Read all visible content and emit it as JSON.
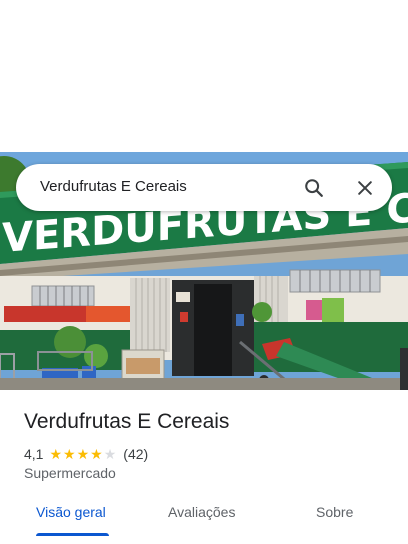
{
  "search": {
    "query": "Verdufrutas E Cereais"
  },
  "place": {
    "name": "Verdufrutas E Cereais",
    "rating": "4,1",
    "stars_value": 4.1,
    "review_count": "(42)",
    "category": "Supermercado",
    "storefront_sign": "VERDUFRUTAS E CER"
  },
  "tabs": [
    {
      "label": "Visão geral"
    },
    {
      "label": "Avaliações"
    },
    {
      "label": "Sobre"
    }
  ],
  "colors": {
    "accent": "#0b57d0",
    "star": "#fbbc04",
    "facade_green": "#1b7a45"
  },
  "icons": {
    "search": "search-icon",
    "close": "close-icon"
  }
}
